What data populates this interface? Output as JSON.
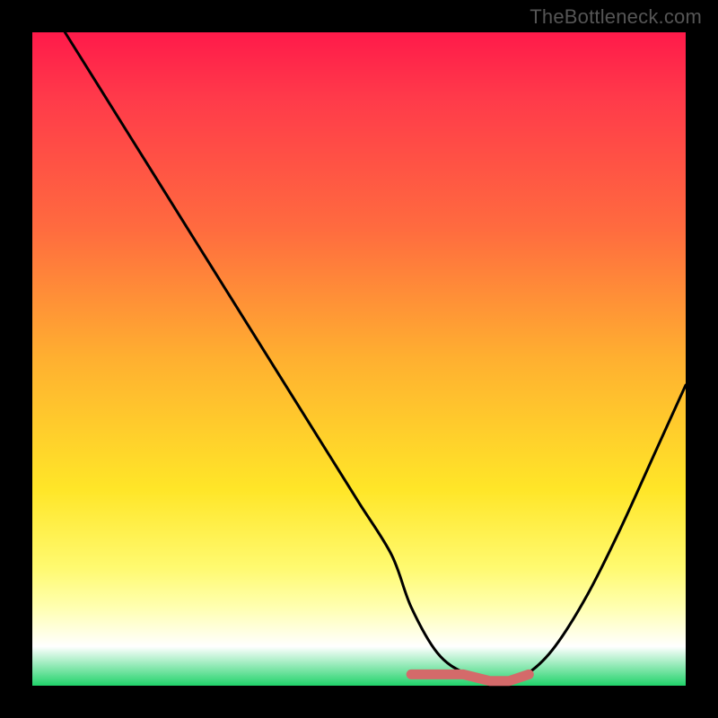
{
  "watermark": {
    "text": "TheBottleneck.com"
  },
  "colors": {
    "frame": "#000000",
    "curve": "#000000",
    "nadir_marker": "#d46a6a",
    "gradient_stops": [
      "#ff1a4a",
      "#ff6b3f",
      "#ffb030",
      "#ffe628",
      "#ffffb0",
      "#ffffff",
      "#21d36a"
    ]
  },
  "chart_data": {
    "type": "line",
    "title": "",
    "xlabel": "",
    "ylabel": "",
    "xlim": [
      0,
      100
    ],
    "ylim": [
      0,
      100
    ],
    "grid": false,
    "legend": false,
    "series": [
      {
        "name": "bottleneck-curve",
        "x": [
          5,
          10,
          15,
          20,
          25,
          30,
          35,
          40,
          45,
          50,
          55,
          58,
          62,
          66,
          70,
          73,
          76,
          80,
          85,
          90,
          95,
          100
        ],
        "values": [
          100,
          92,
          84,
          76,
          68,
          60,
          52,
          44,
          36,
          28,
          20,
          12,
          5,
          2,
          1,
          1,
          2,
          6,
          14,
          24,
          35,
          46
        ]
      }
    ],
    "annotations": [
      {
        "name": "nadir-segment",
        "x_range": [
          58,
          76
        ],
        "y": 1
      }
    ]
  }
}
